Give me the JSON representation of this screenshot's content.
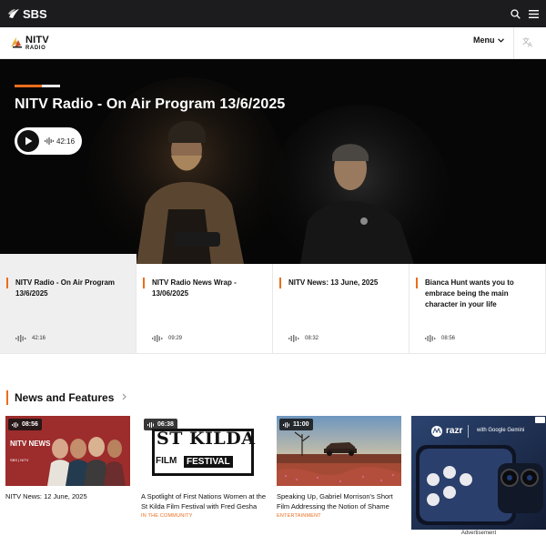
{
  "topbar": {
    "brand": "SBS"
  },
  "header": {
    "logo_main": "NITV",
    "logo_sub": "RADIO",
    "menu_label": "Menu"
  },
  "hero": {
    "title": "NITV Radio - On Air Program 13/6/2025",
    "duration": "42:16"
  },
  "episodes": [
    {
      "title": "NITV Radio - On Air Program 13/6/2025",
      "duration": "42:16",
      "active": true
    },
    {
      "title": "NITV Radio News Wrap - 13/06/2025",
      "duration": "09:29"
    },
    {
      "title": "NITV News: 13 June, 2025",
      "duration": "08:32"
    },
    {
      "title": "Bianca Hunt wants you to embrace being the main character in your life",
      "duration": "08:56"
    }
  ],
  "section": {
    "title": "News and Features"
  },
  "cards": [
    {
      "duration": "08:56",
      "title": "NITV News: 12 June, 2025",
      "tag": "",
      "thumb_brand": "NITV NEWS",
      "thumb_footer": "SBS | NITV"
    },
    {
      "duration": "06:38",
      "title": "A Spotlight of First Nations Women at the St Kilda Film Festival with Fred Gesha",
      "tag": "IN THE COMMUNITY",
      "thumb_l1": "ST KILDA",
      "thumb_l2": "FILM",
      "thumb_l3": "FESTIVAL"
    },
    {
      "duration": "11:00",
      "title": "Speaking Up, Gabriel Morrison's Short Film Addressing the Notion of Shame",
      "tag": "ENTERTAINMENT"
    }
  ],
  "ad": {
    "brand": "razr",
    "tagline": "with Google Gemini",
    "label": "Advertisement"
  },
  "colors": {
    "accent": "#ea6d1c",
    "topbar": "#1c1c1e"
  }
}
